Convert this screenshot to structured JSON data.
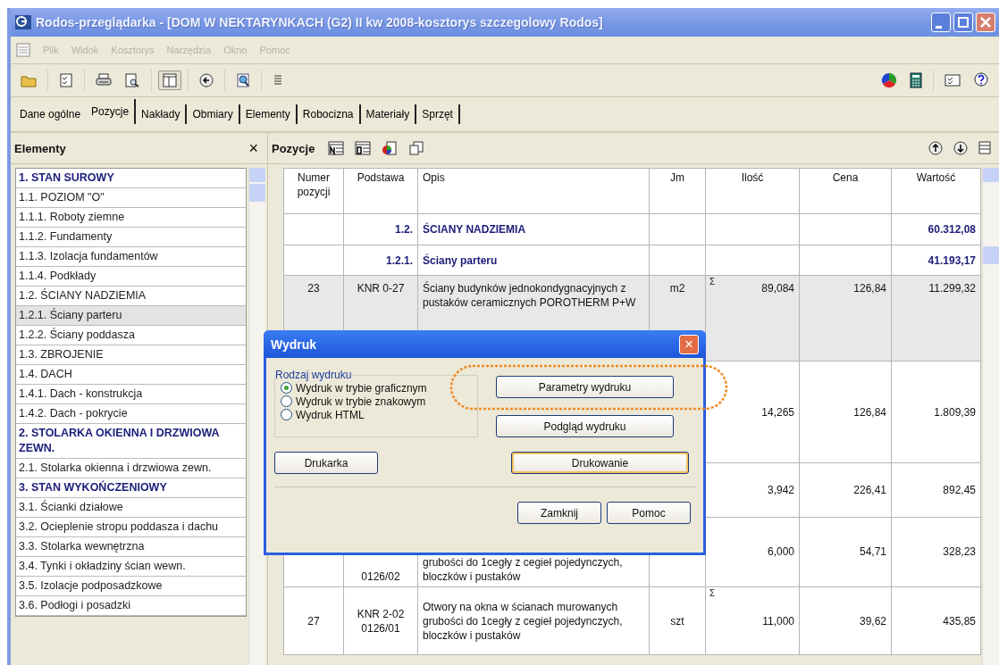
{
  "window": {
    "title": "Rodos-przeglądarka - [DOM W NEKTARYNKACH  (G2)  II kw 2008-kosztorys szczegolowy Rodos]"
  },
  "menu": [
    {
      "label": "Plik",
      "disabled": true
    },
    {
      "label": "Widok",
      "disabled": true
    },
    {
      "label": "Kosztorys",
      "disabled": true
    },
    {
      "label": "Narzędzia",
      "disabled": true
    },
    {
      "label": "Okno",
      "disabled": true
    },
    {
      "label": "Pomoc",
      "disabled": true
    }
  ],
  "tabs": [
    {
      "label": "Dane ogólne",
      "selected": false
    },
    {
      "label": "Pozycje",
      "selected": true
    },
    {
      "label": "Nakłady",
      "selected": false
    },
    {
      "label": "Obmiary",
      "selected": false
    },
    {
      "label": "Elementy",
      "selected": false
    },
    {
      "label": "Robocizna",
      "selected": false
    },
    {
      "label": "Materiały",
      "selected": false
    },
    {
      "label": "Sprzęt",
      "selected": false
    }
  ],
  "sidebar": {
    "title": "Elementy",
    "close": "×",
    "items": [
      {
        "label": "1. STAN SUROWY",
        "kind": "section",
        "selected": false
      },
      {
        "label": "1.1. POZIOM \"O\"",
        "kind": "item",
        "selected": false
      },
      {
        "label": "1.1.1. Roboty ziemne",
        "kind": "item",
        "selected": false
      },
      {
        "label": "1.1.2. Fundamenty",
        "kind": "item",
        "selected": false
      },
      {
        "label": "1.1.3. Izolacja fundamentów",
        "kind": "item",
        "selected": false
      },
      {
        "label": "1.1.4. Podkłady",
        "kind": "item",
        "selected": false
      },
      {
        "label": "1.2. ŚCIANY NADZIEMIA",
        "kind": "item",
        "selected": false
      },
      {
        "label": "1.2.1. Ściany parteru",
        "kind": "item",
        "selected": true
      },
      {
        "label": "1.2.2. Ściany poddasza",
        "kind": "item",
        "selected": false
      },
      {
        "label": "1.3. ZBROJENIE",
        "kind": "item",
        "selected": false
      },
      {
        "label": "1.4. DACH",
        "kind": "item",
        "selected": false
      },
      {
        "label": "1.4.1. Dach - konstrukcja",
        "kind": "item",
        "selected": false
      },
      {
        "label": "1.4.2. Dach - pokrycie",
        "kind": "item",
        "selected": false
      },
      {
        "label": "2. STOLARKA OKIENNA I DRZWIOWA ZEWN.",
        "kind": "section",
        "selected": false
      },
      {
        "label": "2.1. Stolarka okienna i drzwiowa zewn.",
        "kind": "item",
        "selected": false
      },
      {
        "label": "3. STAN WYKOŃCZENIOWY",
        "kind": "section",
        "selected": false
      },
      {
        "label": "3.1. Ścianki działowe",
        "kind": "item",
        "selected": false
      },
      {
        "label": "3.2. Ocieplenie stropu poddasza i dachu",
        "kind": "item",
        "selected": false
      },
      {
        "label": "3.3. Stolarka wewnętrzna",
        "kind": "item",
        "selected": false
      },
      {
        "label": "3.4. Tynki i okładziny ścian wewn.",
        "kind": "item",
        "selected": false
      },
      {
        "label": "3.5. Izolacje podposadzkowe",
        "kind": "item",
        "selected": false
      },
      {
        "label": "3.6. Podłogi i posadzki",
        "kind": "item",
        "selected": false
      }
    ]
  },
  "positions": {
    "title": "Pozycje",
    "columns": [
      "Numer pozycji",
      "Podstawa",
      "Opis",
      "Jm",
      "Ilość",
      "Cena",
      "Wartość"
    ],
    "rows": [
      {
        "kind": "group",
        "selected": false,
        "podstawa": "1.2.",
        "opis": "ŚCIANY NADZIEMIA",
        "wartosc": "60.312,08"
      },
      {
        "kind": "group",
        "selected": false,
        "podstawa": "1.2.1.",
        "opis": "Ściany parteru",
        "wartosc": "41.193,17"
      },
      {
        "kind": "position",
        "selected": true,
        "numer": "23",
        "podstawa": "KNR 0-27",
        "opis": "Ściany budynków jednokondygnacyjnych z pustaków ceramicznych POROTHERM P+W",
        "jm": "m2",
        "sum_mark": "Σ",
        "ilosc": "89,084",
        "cena": "126,84",
        "wartosc": "11.299,32"
      },
      {
        "kind": "position",
        "selected": false,
        "ilosc": "14,265",
        "cena": "126,84",
        "wartosc": "1.809,39"
      },
      {
        "kind": "position",
        "selected": false,
        "ilosc": "3,942",
        "cena": "226,41",
        "wartosc": "892,45"
      },
      {
        "kind": "position",
        "selected": false,
        "podstawa": "0126/02",
        "opis": "grubości do 1cegły z cegieł pojedynczych, bloczków i pustaków",
        "ilosc": "6,000",
        "cena": "54,71",
        "wartosc": "328,23"
      },
      {
        "kind": "position",
        "selected": false,
        "numer": "27",
        "podstawa": "KNR 2-02 0126/01",
        "opis": "Otwory na okna w ścianach murowanych grubości do 1cegły z cegieł pojedynczych, bloczków i pustaków",
        "jm": "szt",
        "sum_mark": "Σ",
        "ilosc": "11,000",
        "cena": "39,62",
        "wartosc": "435,85"
      }
    ]
  },
  "dialog": {
    "title": "Wydruk",
    "close": "×",
    "group_label": "Rodzaj wydruku",
    "options": [
      {
        "label": "Wydruk w trybie graficznym",
        "selected": true
      },
      {
        "label": "Wydruk w trybie znakowym",
        "selected": false
      },
      {
        "label": "Wydruk HTML",
        "selected": false
      }
    ],
    "buttons": [
      {
        "label": "Parametry wydruku",
        "kind": "params",
        "highlighted": true,
        "default": false
      },
      {
        "label": "Podgląd wydruku",
        "kind": "preview",
        "highlighted": false,
        "default": false
      },
      {
        "label": "Drukarka",
        "kind": "printer",
        "highlighted": false,
        "default": false
      },
      {
        "label": "Drukowanie",
        "kind": "print",
        "highlighted": false,
        "default": true
      },
      {
        "label": "Zamknij",
        "kind": "close",
        "highlighted": false,
        "default": false
      },
      {
        "label": "Pomoc",
        "kind": "help",
        "highlighted": false,
        "default": false
      }
    ]
  }
}
